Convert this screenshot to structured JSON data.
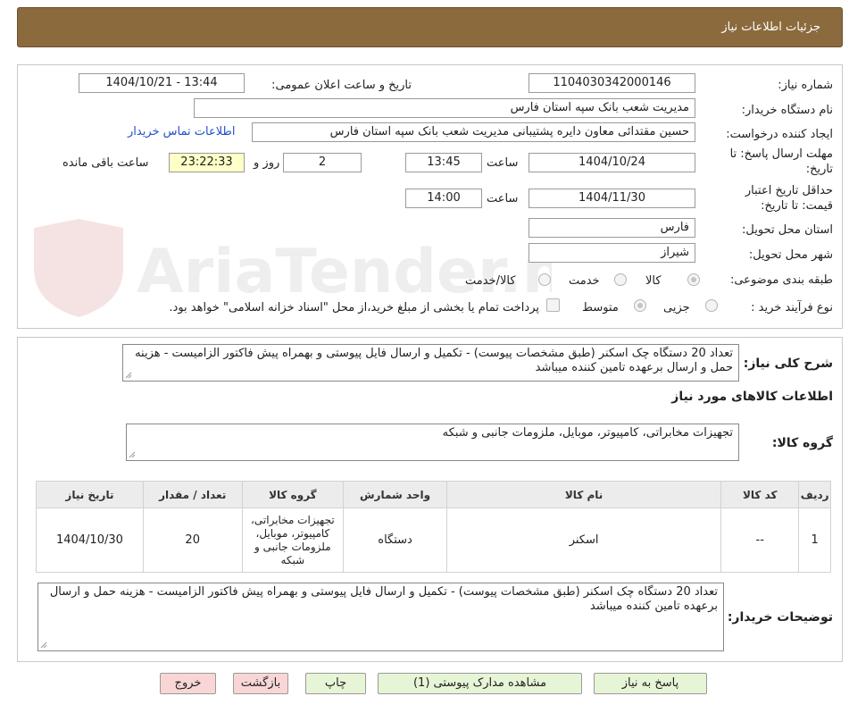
{
  "header": {
    "title": "جزئیات اطلاعات نیاز"
  },
  "form": {
    "need_number_label": "شماره نیاز:",
    "need_number": "1104030342000146",
    "announce_label": "تاریخ و ساعت اعلان عمومی:",
    "announce_value": "1404/10/21 - 13:44",
    "buyer_org_label": "نام دستگاه خریدار:",
    "buyer_org": "مدیریت شعب بانک سپه استان فارس",
    "requester_label": "ایجاد کننده درخواست:",
    "requester": "حسین مقتدائی معاون  دایره پشتیبانی مدیریت شعب بانک سپه استان فارس",
    "contact_link": "اطلاعات تماس خریدار",
    "deadline_label": "مهلت ارسال پاسخ: تا تاریخ:",
    "deadline_date": "1404/10/24",
    "time_label": "ساعت",
    "deadline_time": "13:45",
    "days_value": "2",
    "days_label": "روز و",
    "remaining_time": "23:22:33",
    "remaining_label": "ساعت باقی مانده",
    "validity_label": "حداقل تاریخ اعتبار قیمت: تا تاریخ:",
    "validity_date": "1404/11/30",
    "validity_time": "14:00",
    "province_label": "استان محل تحویل:",
    "province": "فارس",
    "city_label": "شهر محل تحویل:",
    "city": "شیراز",
    "category_label": "طبقه بندی موضوعی:",
    "category_options": [
      "کالا",
      "خدمت",
      "کالا/خدمت"
    ],
    "process_label": "نوع فرآیند خرید :",
    "process_options": [
      "جزیی",
      "متوسط"
    ],
    "payment_note": "پرداخت تمام یا بخشی از مبلغ خرید،از محل \"اسناد خزانه اسلامی\" خواهد بود."
  },
  "watermark": {
    "text": "AriaTender.neT"
  },
  "summary": {
    "label": "شرح کلی نیاز:",
    "text": "تعداد 20 دستگاه چک اسکنر (طبق مشخصات پیوست) - تکمیل و ارسال فایل پیوستی و بهمراه پیش فاکتور الزامیست - هزینه حمل و ارسال برعهده تامین کننده میباشد",
    "items_heading": "اطلاعات کالاهای مورد نیاز",
    "group_label": "گروه کالا:",
    "group_value": "تجهیزات مخابراتی، کامپیوتر، موبایل، ملزومات جانبی و شبکه"
  },
  "table": {
    "headers": [
      "ردیف",
      "کد کالا",
      "نام کالا",
      "واحد شمارش",
      "گروه کالا",
      "تعداد / مقدار",
      "تاریخ نیاز"
    ],
    "rows": [
      [
        "1",
        "--",
        "اسکنر",
        "دستگاه",
        "تجهیزات مخابراتی، کامپیوتر، موبایل، ملزومات جانبی و شبکه",
        "20",
        "1404/10/30"
      ]
    ]
  },
  "buyer_notes": {
    "label": "توضیحات خریدار:",
    "text": "تعداد 20 دستگاه چک اسکنر (طبق مشخصات پیوست) - تکمیل و ارسال فایل پیوستی و بهمراه پیش فاکتور الزامیست - هزینه حمل و ارسال برعهده تامین کننده میباشد"
  },
  "buttons": {
    "reply": "پاسخ به نیاز",
    "attachments": "مشاهده مدارک پیوستی (1)",
    "print": "چاپ",
    "back": "بازگشت",
    "exit": "خروج"
  },
  "colors": {
    "header_bg": "#8b6b3d",
    "green_button": "#e6f5d6",
    "pink_button": "#f9d6d6",
    "link": "#2150c8",
    "remaining_bg": "#ffffc8"
  }
}
